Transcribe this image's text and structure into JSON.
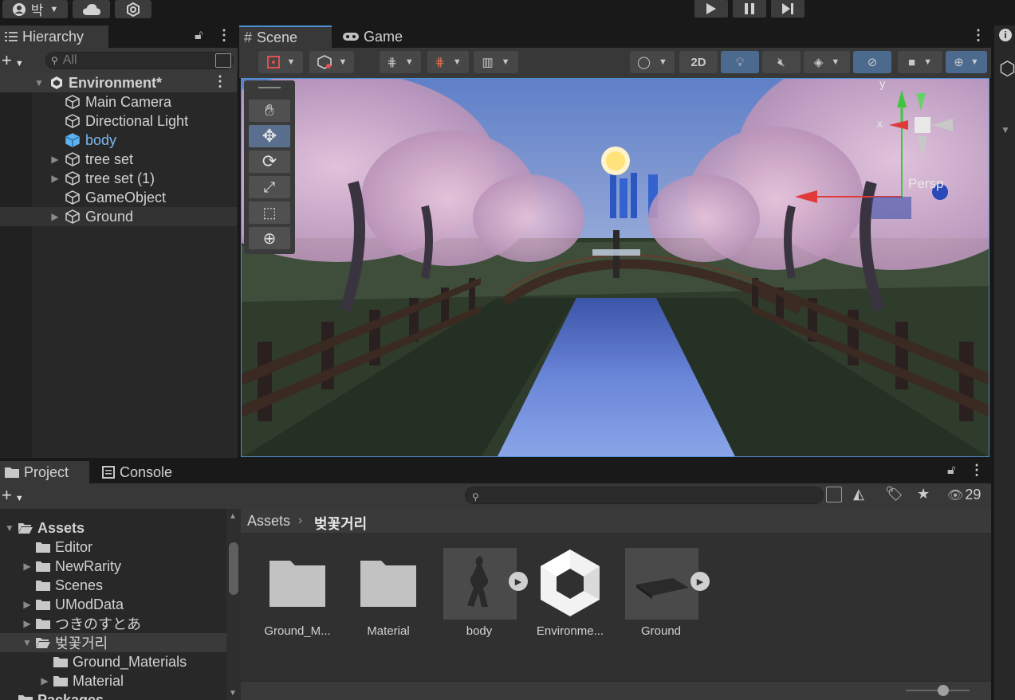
{
  "topbar": {
    "account_label": "박",
    "account_icon": "account-icon",
    "cloud_icon": "cloud-icon",
    "collab_icon": "collab-icon",
    "play_icon": "play-icon",
    "pause_icon": "pause-icon",
    "step_icon": "step-icon"
  },
  "hierarchy": {
    "tab_label": "Hierarchy",
    "search_placeholder": "All",
    "scene_name": "Environment*",
    "items": [
      {
        "label": "Main Camera",
        "expandable": false
      },
      {
        "label": "Directional Light",
        "expandable": false
      },
      {
        "label": "body",
        "expandable": false,
        "prefab": true
      },
      {
        "label": "tree set",
        "expandable": true
      },
      {
        "label": "tree set (1)",
        "expandable": true
      },
      {
        "label": "GameObject",
        "expandable": false
      },
      {
        "label": "Ground",
        "expandable": true
      }
    ]
  },
  "scene": {
    "tabs": [
      {
        "label": "Scene",
        "icon": "grid-icon"
      },
      {
        "label": "Game",
        "icon": "gamepad-icon"
      }
    ],
    "toolbar_2d": "2D",
    "gizmo_label": "Persp",
    "gizmo_axes": {
      "x": "x",
      "y": "y"
    }
  },
  "project": {
    "tabs": [
      {
        "label": "Project",
        "icon": "folder-icon"
      },
      {
        "label": "Console",
        "icon": "console-icon"
      }
    ],
    "hidden_count": "29",
    "tree": [
      {
        "label": "Assets",
        "level": 0,
        "bold": true,
        "open": true
      },
      {
        "label": "Editor",
        "level": 1
      },
      {
        "label": "NewRarity",
        "level": 1,
        "expandable": true
      },
      {
        "label": "Scenes",
        "level": 1
      },
      {
        "label": "UModData",
        "level": 1,
        "expandable": true
      },
      {
        "label": "つきのすとあ",
        "level": 1,
        "expandable": true
      },
      {
        "label": "벚꽃거리",
        "level": 1,
        "open": true,
        "selected": true
      },
      {
        "label": "Ground_Materials",
        "level": 2
      },
      {
        "label": "Material",
        "level": 2,
        "expandable": true
      },
      {
        "label": "Packages",
        "level": 0,
        "bold": true
      }
    ],
    "breadcrumb": [
      "Assets",
      "벚꽃거리"
    ],
    "assets": [
      {
        "label": "Ground_M...",
        "type": "folder"
      },
      {
        "label": "Material",
        "type": "folder"
      },
      {
        "label": "body",
        "type": "model"
      },
      {
        "label": "Environme...",
        "type": "unity-scene"
      },
      {
        "label": "Ground",
        "type": "model"
      }
    ]
  },
  "colors": {
    "accent": "#4d8fd6",
    "panel": "#282828",
    "toolbar": "#383838",
    "selected": "#2c5d87"
  }
}
